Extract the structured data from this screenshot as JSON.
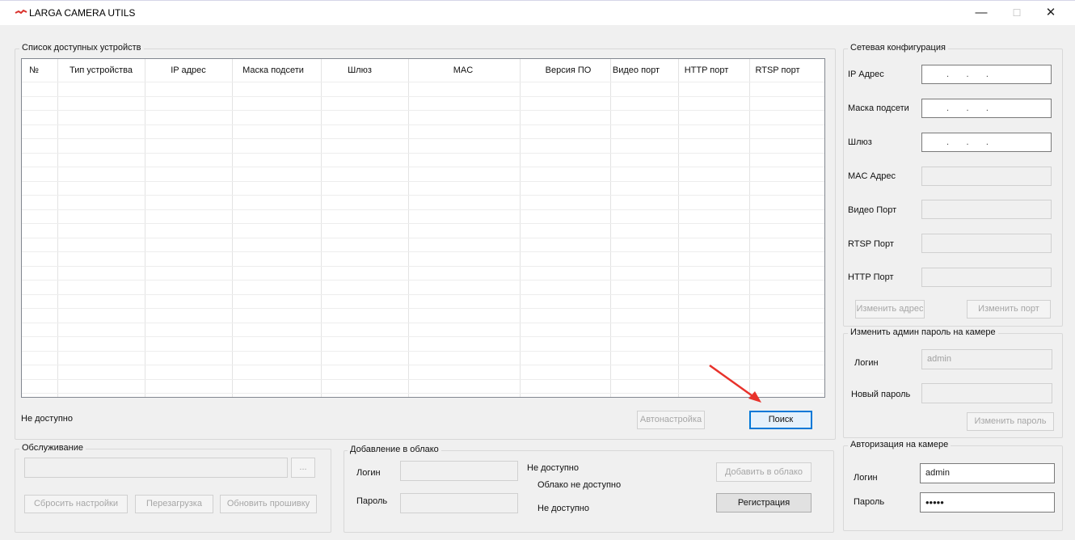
{
  "window": {
    "title": "LARGA CAMERA UTILS",
    "minimize": "—",
    "maximize": "☐",
    "close": "✕"
  },
  "devices": {
    "legend": "Список доступных устройств",
    "columns": [
      "№",
      "Тип устройства",
      "IP адрес",
      "Маска подсети",
      "Шлюз",
      "MAC",
      "Версия ПО",
      "Видео порт",
      "HTTP порт",
      "RTSP порт"
    ],
    "rows": [],
    "status": "Не доступно",
    "autoconfig_button": "Автонастройка",
    "search_button": "Поиск"
  },
  "network": {
    "legend": "Сетевая конфигурация",
    "ip_label": "IP Адрес",
    "ip_value": ".       .       .",
    "mask_label": "Маска подсети",
    "mask_value": ".       .       .",
    "gateway_label": "Шлюз",
    "gateway_value": ".       .       .",
    "mac_label": "MAC Адрес",
    "video_port_label": "Видео Порт",
    "rtsp_port_label": "RTSP Порт",
    "http_port_label": "HTTP Порт",
    "change_address_button": "Изменить адрес",
    "change_port_button": "Изменить порт"
  },
  "admin_password": {
    "legend": "Изменить админ пароль на камере",
    "login_label": "Логин",
    "login_value": "admin",
    "new_password_label": "Новый пароль",
    "change_button": "Изменить пароль"
  },
  "camera_auth": {
    "legend": "Авторизация на камере",
    "login_label": "Логин",
    "login_value": "admin",
    "password_label": "Пароль",
    "password_value": "•••••"
  },
  "service": {
    "legend": "Обслуживание",
    "browse_button": "...",
    "reset_button": "Сбросить настройки",
    "reboot_button": "Перезагрузка",
    "firmware_button": "Обновить прошивку"
  },
  "cloud": {
    "legend": "Добавление в облако",
    "login_label": "Логин",
    "password_label": "Пароль",
    "status_1": "Не доступно",
    "status_2": "Облако не доступно",
    "status_3": "Не доступно",
    "add_button": "Добавить в облако",
    "register_button": "Регистрация"
  },
  "colors": {
    "accent": "#0078d7",
    "arrow": "#e8322b",
    "icon": "#d9322c"
  }
}
